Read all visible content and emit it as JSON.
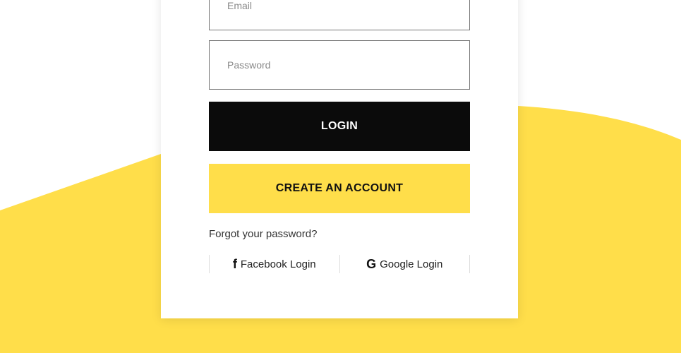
{
  "form": {
    "email_placeholder": "Email",
    "password_placeholder": "Password",
    "login_label": "LOGIN",
    "create_label": "CREATE AN ACCOUNT",
    "forgot_label": "Forgot your password?"
  },
  "social": {
    "facebook_icon": "f",
    "facebook_label": "Facebook Login",
    "google_icon": "G",
    "google_label": "Google Login"
  },
  "colors": {
    "accent": "#ffde4a",
    "button_dark": "#0b0b0b"
  },
  "icons": {
    "facebook": "facebook-icon",
    "google": "google-icon"
  }
}
